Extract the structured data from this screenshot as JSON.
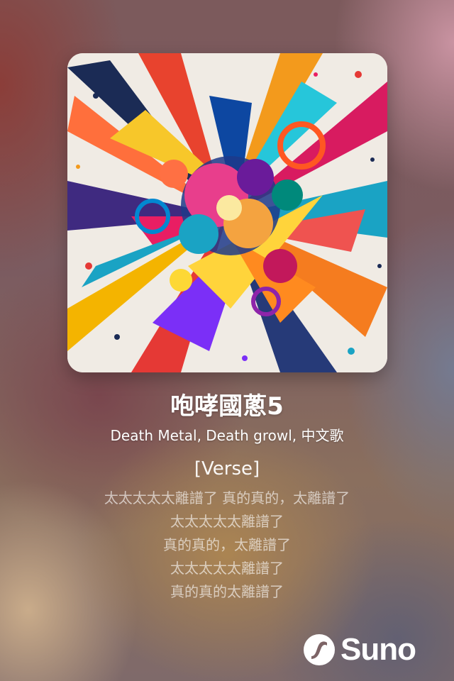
{
  "song": {
    "title": "咆哮國蔥5",
    "tags": "Death Metal, Death growl, 中文歌",
    "cover_description": "abstract-colorful-explosion-art"
  },
  "lyrics": {
    "section": "[Verse]",
    "lines": [
      "太太太太太離譜了 真的真的，太離譜了",
      "太太太太太離譜了",
      "真的真的，太離譜了",
      "太太太太太離譜了",
      "真的真的太離譜了"
    ]
  },
  "brand": {
    "name": "Suno",
    "icon": "suno-logo-icon"
  },
  "colors": {
    "text": "#ffffff",
    "lyric_dim": "#c9b9b6"
  }
}
